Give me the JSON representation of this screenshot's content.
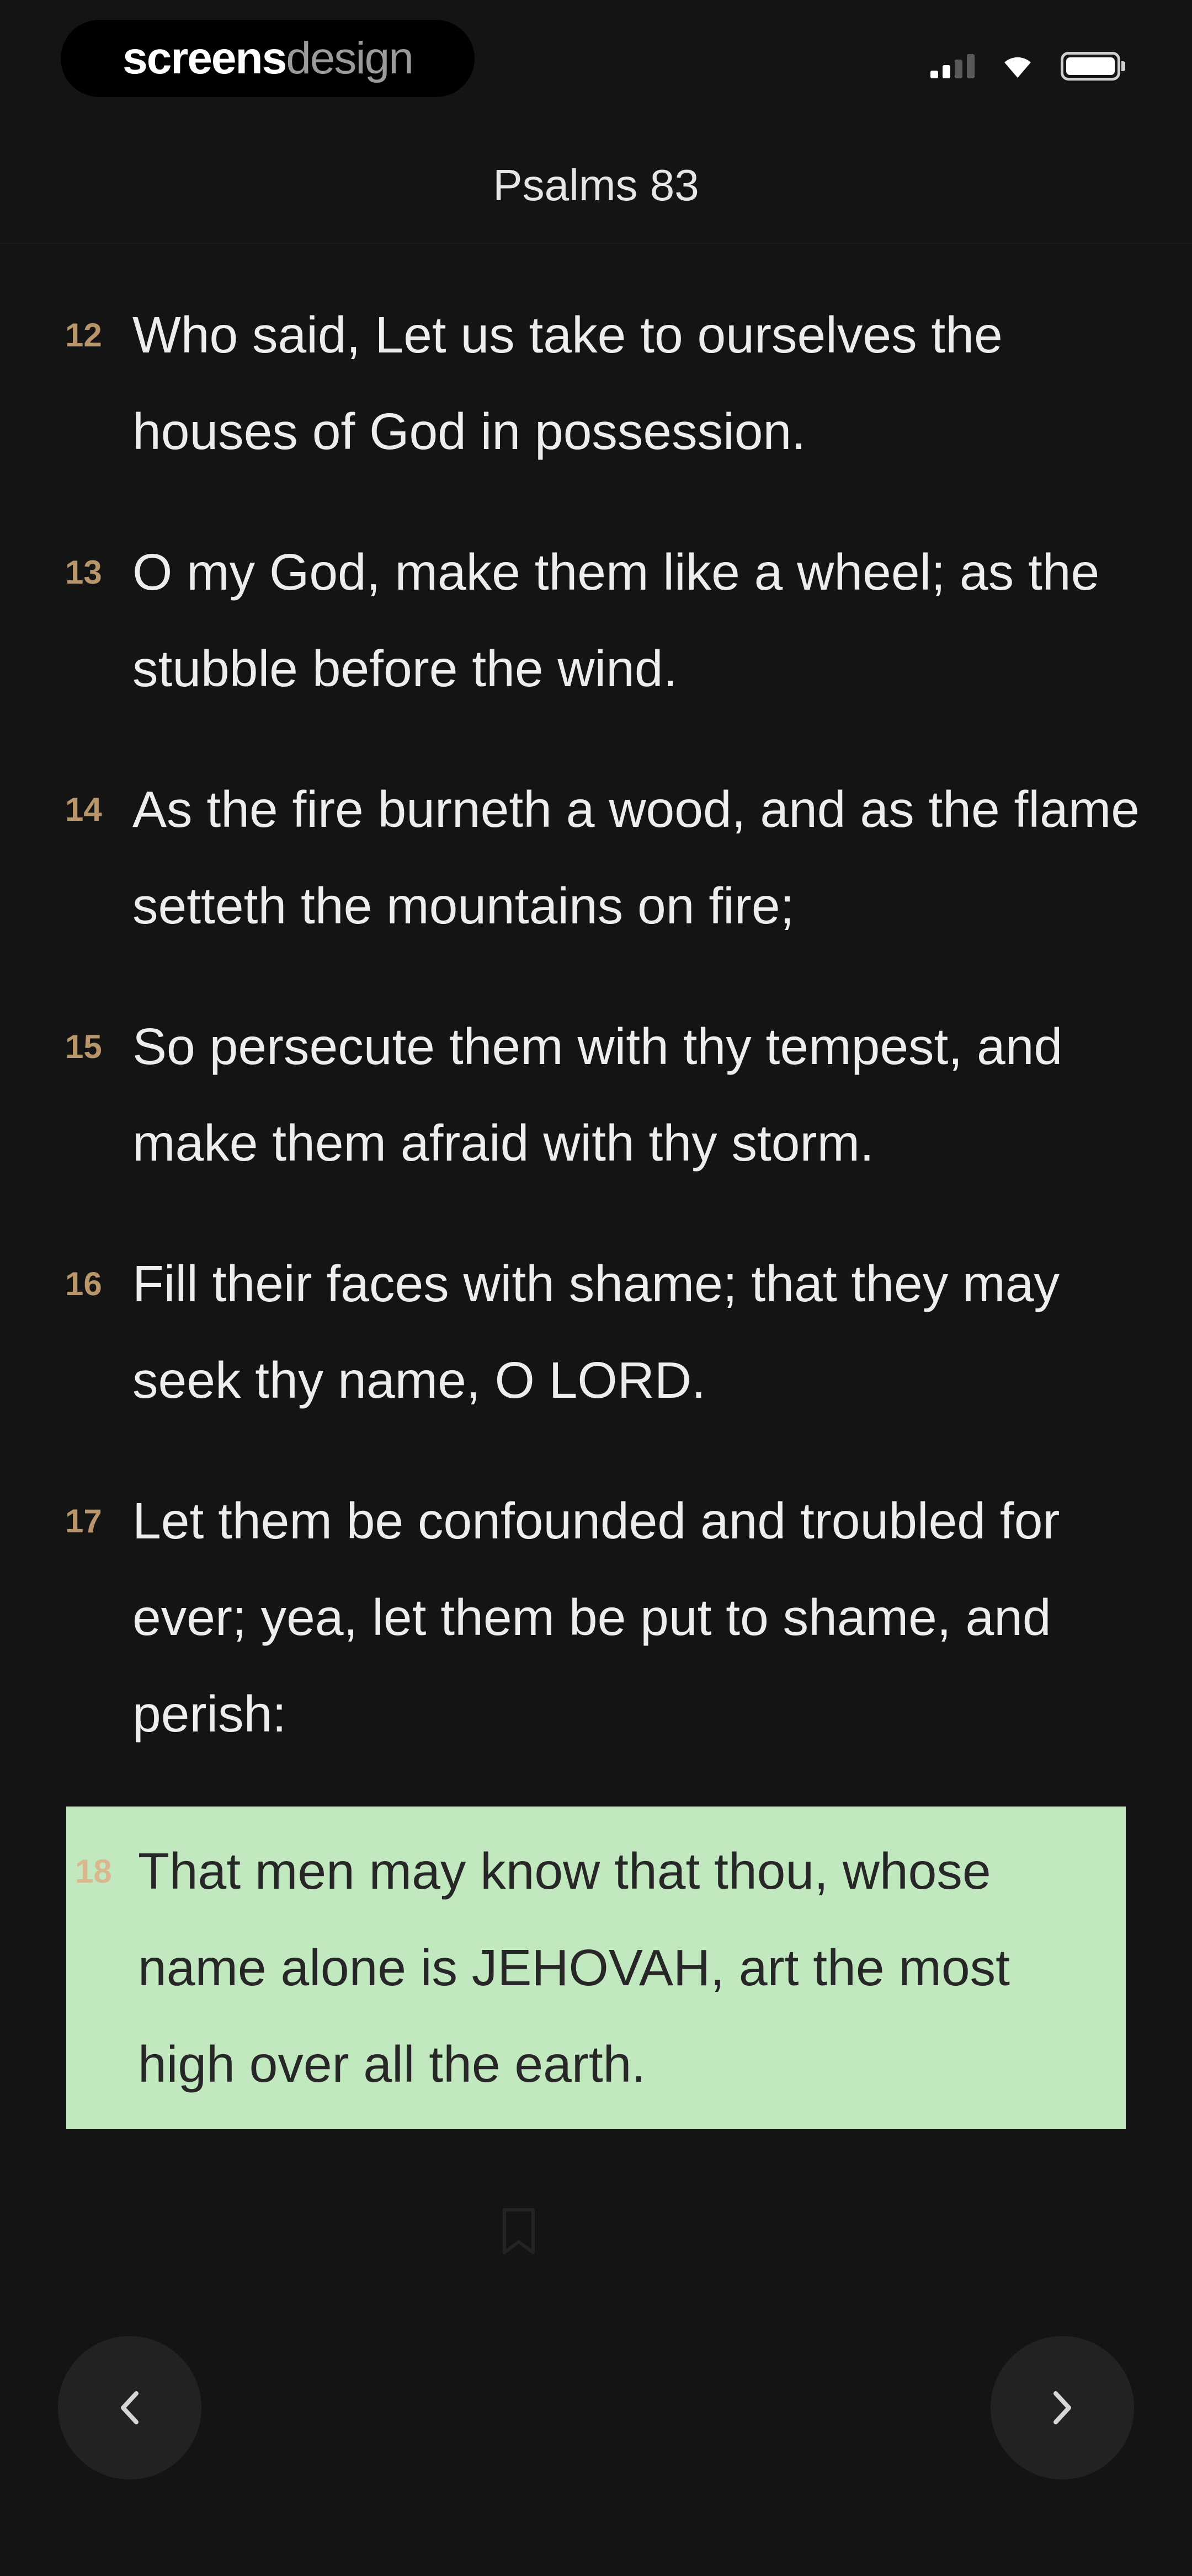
{
  "status_bar": {
    "brand_bold": "screens",
    "brand_light": "design"
  },
  "header": {
    "title": "Psalms 83"
  },
  "verses": [
    {
      "number": "12",
      "text": "Who said, Let us take to ourselves the houses of God in possession."
    },
    {
      "number": "13",
      "text": "O my God, make them like a wheel; as the stubble before the wind."
    },
    {
      "number": "14",
      "text": "As the fire burneth a wood, and as the flame setteth the mountains on fire;"
    },
    {
      "number": "15",
      "text": "So persecute them with thy tempest, and make them afraid with thy storm."
    },
    {
      "number": "16",
      "text": "Fill their faces with shame; that they may seek thy name, O LORD."
    },
    {
      "number": "17",
      "text": "Let them be confounded and troubled for ever; yea, let them be put to shame, and perish:"
    },
    {
      "number": "18",
      "text": "That men may know that thou, whose name alone is JEHOVAH, art the most high over all the earth."
    }
  ],
  "highlight_color": "#c2e8bf",
  "accent_color": "#b8956a",
  "icons": {
    "prev": "chevron-left-icon",
    "next": "chevron-right-icon",
    "bookmark": "bookmark-icon",
    "signal": "signal-icon",
    "wifi": "wifi-icon",
    "battery": "battery-icon"
  }
}
